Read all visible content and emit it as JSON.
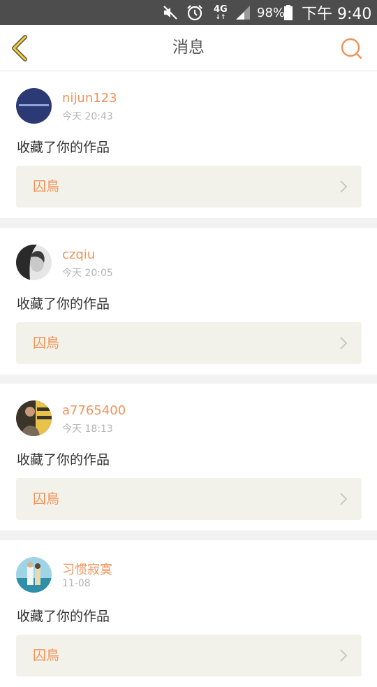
{
  "status_bar": {
    "network": "4G",
    "network_arrows": "↓↑",
    "battery": "98%",
    "time": "下午 9:40"
  },
  "nav": {
    "title": "消息",
    "back_icon": "chevron-left-icon",
    "search_icon": "search-icon",
    "accent_color": "#f0935a"
  },
  "messages": [
    {
      "username": "nijun123",
      "time": "今天 20:43",
      "action": "收藏了你的作品",
      "work_title": "囚鳥"
    },
    {
      "username": "czqiu",
      "time": "今天 20:05",
      "action": "收藏了你的作品",
      "work_title": "囚鳥"
    },
    {
      "username": "a7765400",
      "time": "今天 18:13",
      "action": "收藏了你的作品",
      "work_title": "囚鳥"
    },
    {
      "username": "习惯寂寞",
      "time": "11-08",
      "action": "收藏了你的作品",
      "work_title": "囚鳥"
    }
  ]
}
